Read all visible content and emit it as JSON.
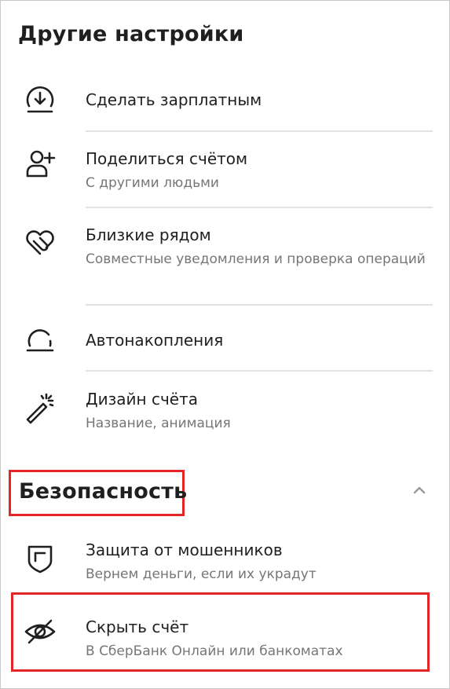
{
  "other_settings": {
    "title": "Другие настройки",
    "items": [
      {
        "icon": "download-circle-icon",
        "label": "Сделать зарплатным",
        "sub": ""
      },
      {
        "icon": "add-person-icon",
        "label": "Поделиться счётом",
        "sub": "С другими людьми"
      },
      {
        "icon": "linked-hearts-icon",
        "label": "Близкие рядом",
        "sub": "Совместные уведомления и проверка операций"
      },
      {
        "icon": "gauge-icon",
        "label": "Автонакопления",
        "sub": ""
      },
      {
        "icon": "magic-wand-icon",
        "label": "Дизайн счёта",
        "sub": "Название, анимация"
      }
    ]
  },
  "security": {
    "title": "Безопасность",
    "collapse_icon": "chevron-up-icon",
    "items": [
      {
        "icon": "shield-icon",
        "label": "Защита от мошенников",
        "sub": "Вернем деньги, если их украдут"
      },
      {
        "icon": "eye-off-icon",
        "label": "Скрыть счёт",
        "sub": "В СберБанк Онлайн или банкоматах"
      }
    ]
  },
  "highlight_color": "#e32525"
}
